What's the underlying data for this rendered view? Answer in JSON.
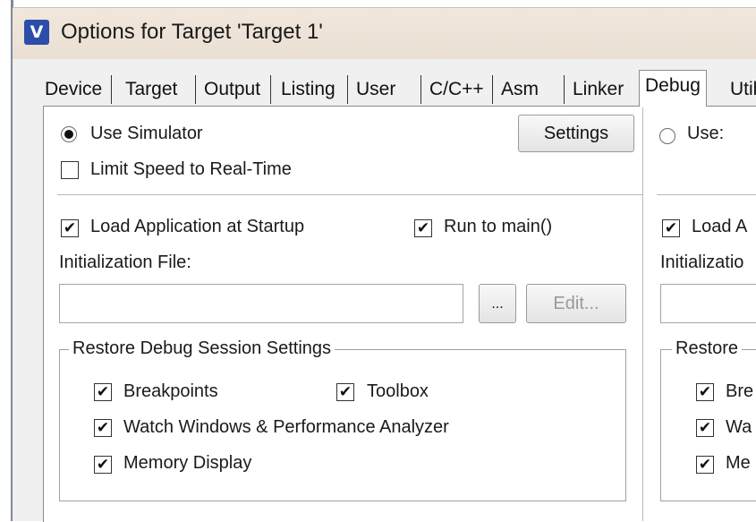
{
  "window": {
    "title": "Options for Target 'Target 1'",
    "icon": "keil-uvision-icon"
  },
  "tabs": [
    {
      "label": "Device"
    },
    {
      "label": "Target"
    },
    {
      "label": "Output"
    },
    {
      "label": "Listing"
    },
    {
      "label": "User"
    },
    {
      "label": "C/C++"
    },
    {
      "label": "Asm"
    },
    {
      "label": "Linker"
    },
    {
      "label": "Debug",
      "active": true
    },
    {
      "label": "Util"
    }
  ],
  "left": {
    "use_simulator": {
      "label": "Use Simulator",
      "checked": true
    },
    "limit_speed": {
      "label": "Limit Speed to Real-Time",
      "checked": false
    },
    "settings_label": "Settings",
    "load_app": {
      "label": "Load Application at Startup",
      "checked": true
    },
    "run_to_main": {
      "label": "Run to main()",
      "checked": true
    },
    "init_file_label": "Initialization File:",
    "init_file_value": "",
    "browse_label": "...",
    "edit_label": "Edit...",
    "restore_group_label": "Restore Debug Session Settings",
    "breakpoints": {
      "label": "Breakpoints",
      "checked": true
    },
    "toolbox": {
      "label": "Toolbox",
      "checked": true
    },
    "watch_windows": {
      "label": "Watch Windows & Performance Analyzer",
      "checked": true
    },
    "memory_display": {
      "label": "Memory Display",
      "checked": true
    }
  },
  "right": {
    "use": {
      "label": "Use:",
      "checked": false
    },
    "load_app_label": "Load A",
    "init_file_label": "Initializatio",
    "restore_group_label": "Restore",
    "item1_label": "Bre",
    "item2_label": "Wa",
    "item3_label": "Me"
  },
  "check_glyph": "✔"
}
